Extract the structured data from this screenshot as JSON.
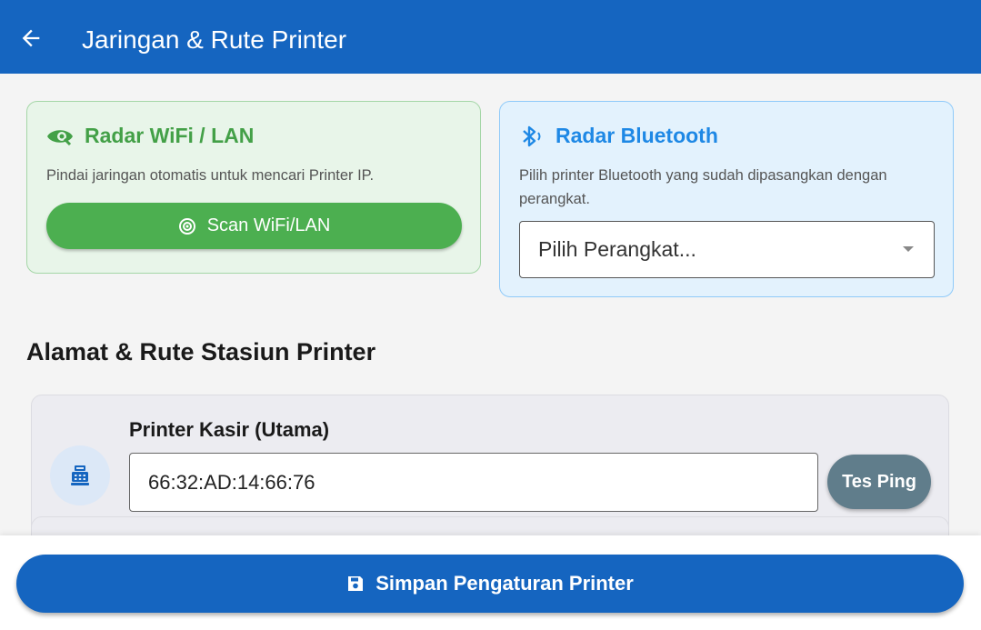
{
  "appbar": {
    "title": "Jaringan & Rute Printer",
    "back_icon": "arrow-left-icon"
  },
  "wifi_card": {
    "title": "Radar WiFi / LAN",
    "description": "Pindai jaringan otomatis untuk mencari Printer IP.",
    "button_label": "Scan WiFi/LAN",
    "accent": "#43a047"
  },
  "bluetooth_card": {
    "title": "Radar Bluetooth",
    "description": "Pilih printer Bluetooth yang sudah dipasangkan dengan perangkat.",
    "select_value": "Pilih Perangkat...",
    "accent": "#1e88e5"
  },
  "section": {
    "title": "Alamat & Rute Stasiun Printer"
  },
  "printers": [
    {
      "name": "Printer Kasir (Utama)",
      "address": "66:32:AD:14:66:76",
      "ping_label": "Tes Ping"
    }
  ],
  "footer": {
    "save_label": "Simpan Pengaturan Printer",
    "accent": "#1565c0"
  }
}
